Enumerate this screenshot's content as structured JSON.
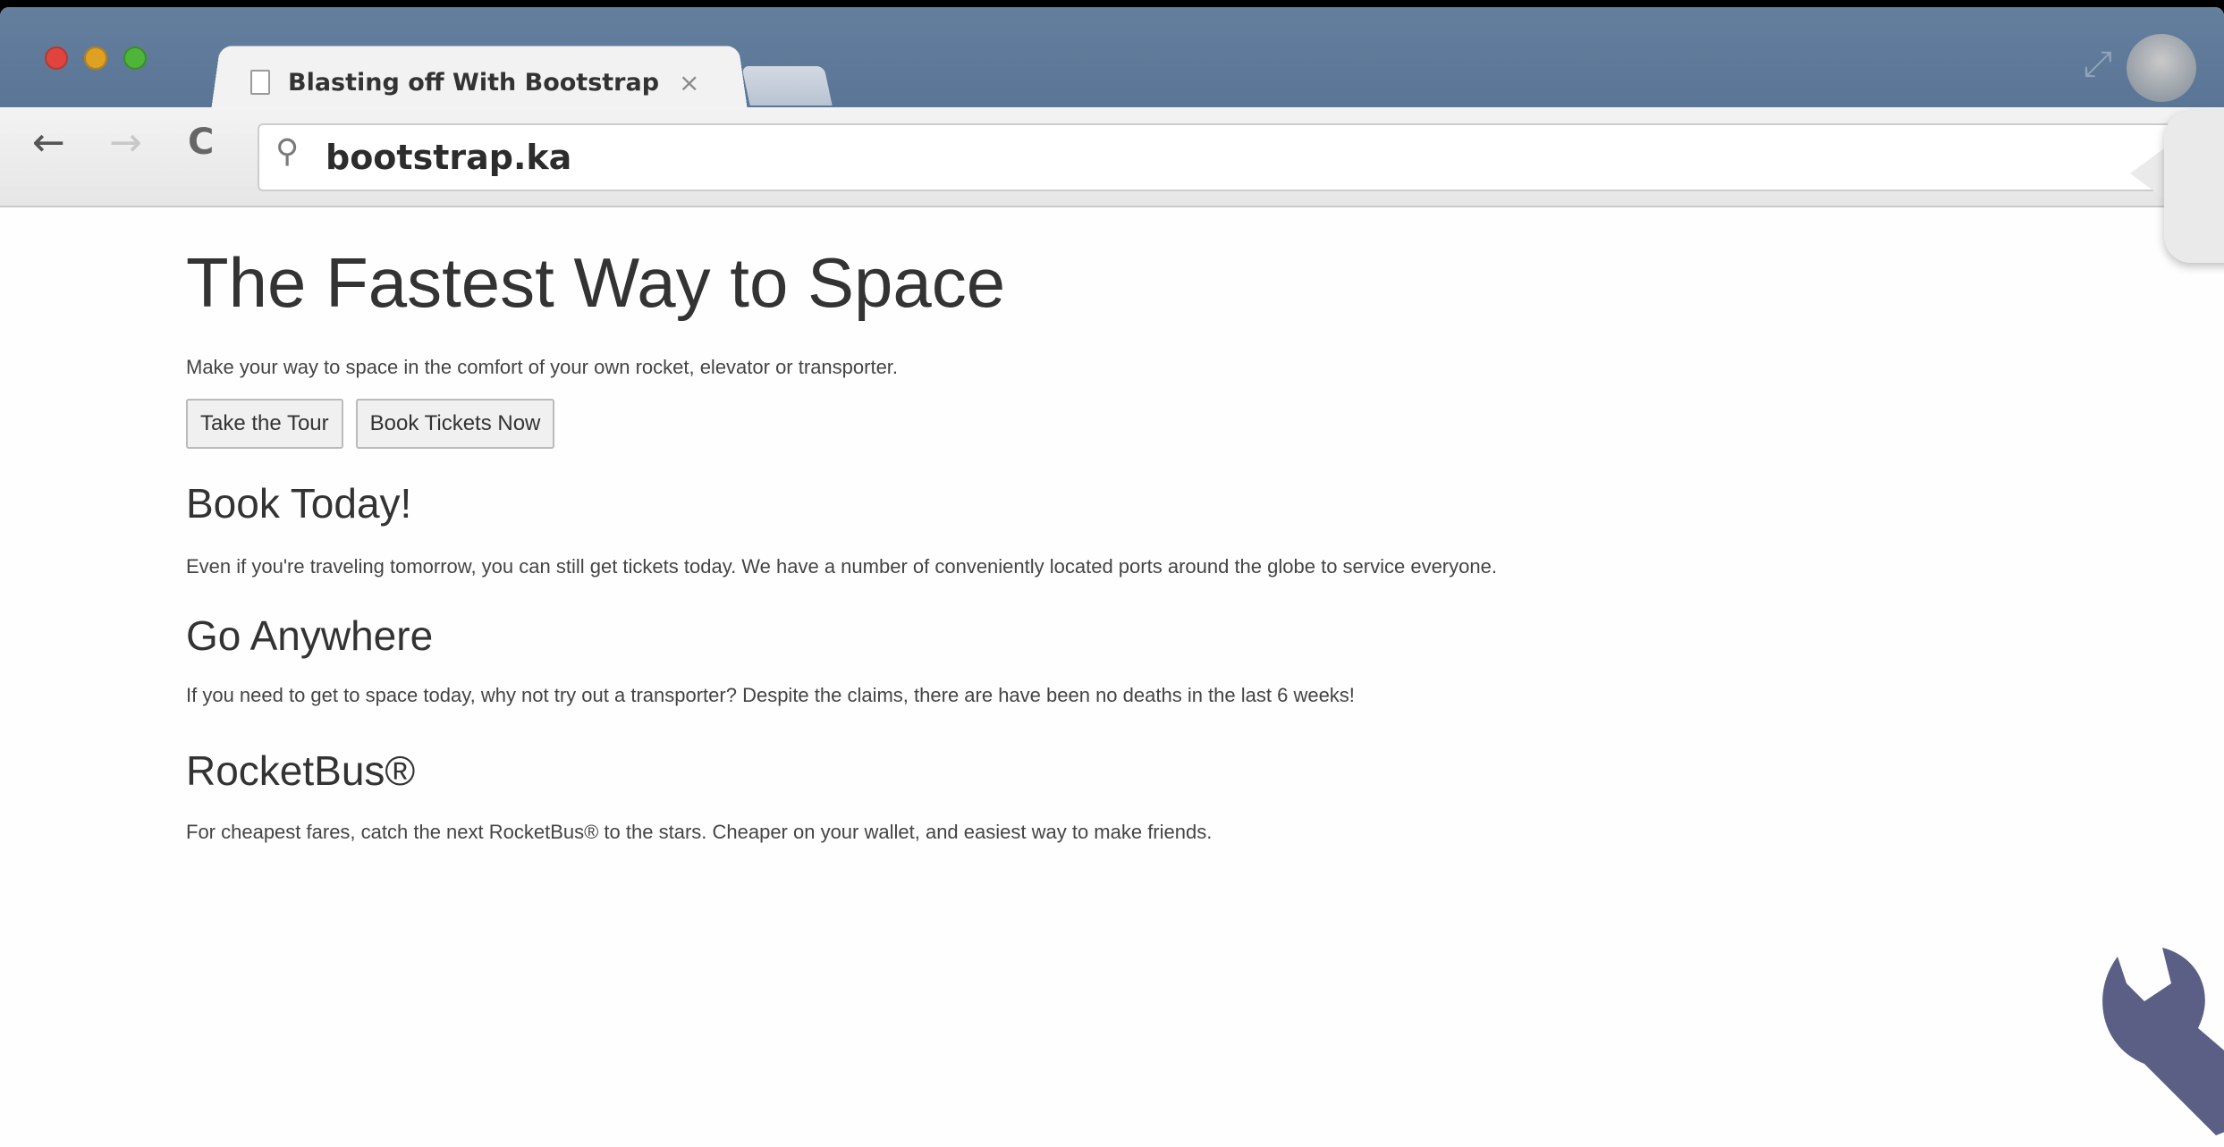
{
  "browser": {
    "tab_title": "Blasting off With Bootstrap",
    "tab_close": "×",
    "address": "bootstrap.ka",
    "icons": {
      "back": "←",
      "forward": "→",
      "reload": "C",
      "search": "⚲",
      "resize": "⤢"
    }
  },
  "page": {
    "title": "The Fastest Way to Space",
    "lead": "Make your way to space in the comfort of your own rocket, elevator or transporter.",
    "buttons": {
      "tour": "Take the Tour",
      "book": "Book Tickets Now"
    },
    "sections": [
      {
        "heading": "Book Today!",
        "text": "Even if you're traveling tomorrow, you can still get tickets today. We have a number of conveniently located ports around the globe to service everyone."
      },
      {
        "heading": "Go Anywhere",
        "text": "If you need to get to space today, why not try out a transporter? Despite the claims, there are have been no deaths in the last 6 weeks!"
      },
      {
        "heading": "RocketBus®",
        "text": "For cheapest fares, catch the next RocketBus® to the stars. Cheaper on your wallet, and easiest way to make friends."
      }
    ]
  },
  "colors": {
    "tabstrip": "#5d7898",
    "traffic_red": "#e0443e",
    "traffic_yellow": "#dea123",
    "traffic_green": "#4fb43a",
    "wrench": "#5b5f86"
  }
}
